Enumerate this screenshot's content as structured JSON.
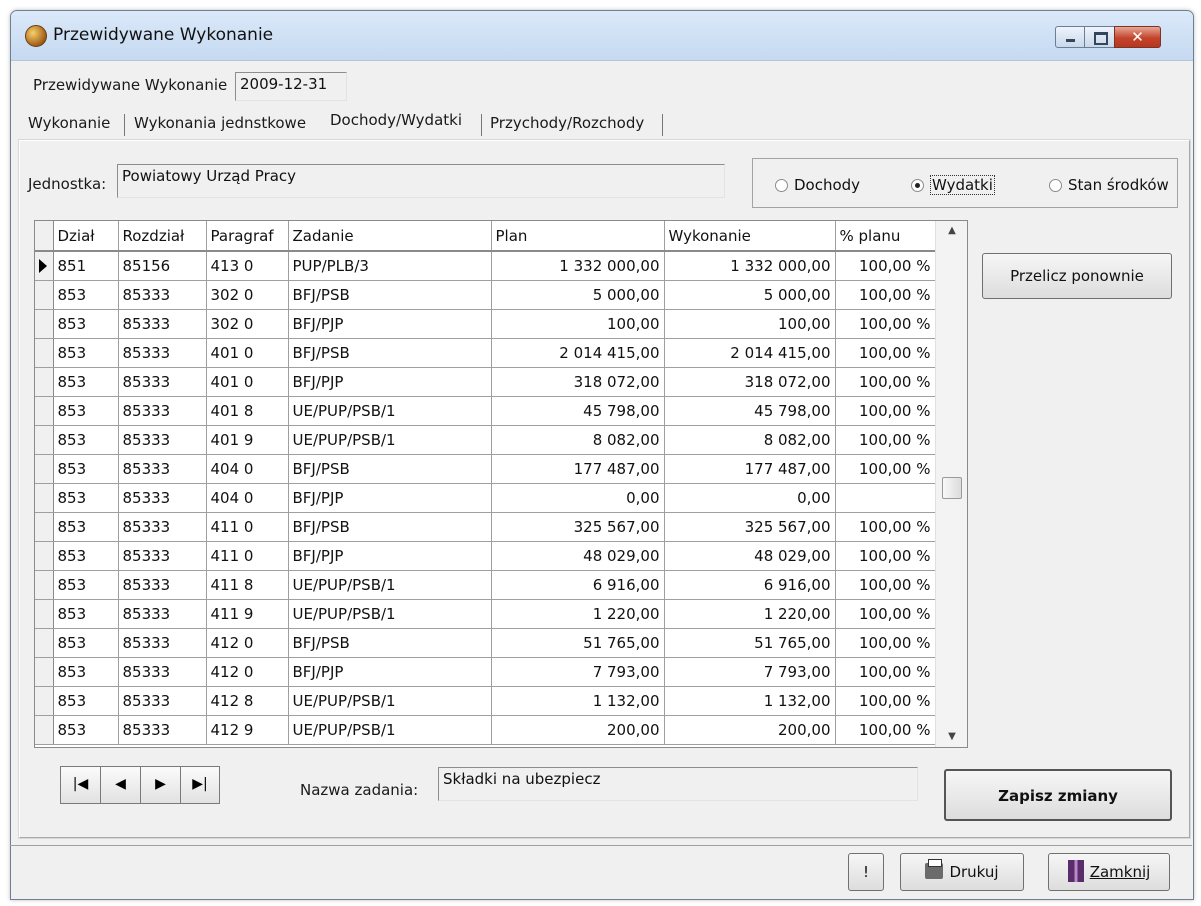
{
  "window": {
    "title": "Przewidywane Wykonanie"
  },
  "header": {
    "date_label": "Przewidywane Wykonanie",
    "date_value": "2009-12-31"
  },
  "tabs": [
    {
      "label": "Wykonanie"
    },
    {
      "label": "Wykonania jednstkowe"
    },
    {
      "label": "Dochody/Wydatki",
      "active": true
    },
    {
      "label": "Przychody/Rozchody"
    }
  ],
  "unit": {
    "label": "Jednostka:",
    "value": "Powiatowy Urząd Pracy"
  },
  "radio": {
    "options": [
      {
        "label": "Dochody",
        "selected": false
      },
      {
        "label": "Wydatki",
        "selected": true
      },
      {
        "label": "Stan środków",
        "selected": false
      }
    ]
  },
  "grid": {
    "columns": [
      "Dział",
      "Rozdział",
      "Paragraf",
      "Zadanie",
      "Plan",
      "Wykonanie",
      "% planu"
    ],
    "rows": [
      [
        "851",
        "85156",
        "413 0",
        "PUP/PLB/3",
        "1 332 000,00",
        "1 332 000,00",
        "100,00 %"
      ],
      [
        "853",
        "85333",
        "302 0",
        "BFJ/PSB",
        "5 000,00",
        "5 000,00",
        "100,00 %"
      ],
      [
        "853",
        "85333",
        "302 0",
        "BFJ/PJP",
        "100,00",
        "100,00",
        "100,00 %"
      ],
      [
        "853",
        "85333",
        "401 0",
        "BFJ/PSB",
        "2 014 415,00",
        "2 014 415,00",
        "100,00 %"
      ],
      [
        "853",
        "85333",
        "401 0",
        "BFJ/PJP",
        "318 072,00",
        "318 072,00",
        "100,00 %"
      ],
      [
        "853",
        "85333",
        "401 8",
        "UE/PUP/PSB/1",
        "45 798,00",
        "45 798,00",
        "100,00 %"
      ],
      [
        "853",
        "85333",
        "401 9",
        "UE/PUP/PSB/1",
        "8 082,00",
        "8 082,00",
        "100,00 %"
      ],
      [
        "853",
        "85333",
        "404 0",
        "BFJ/PSB",
        "177 487,00",
        "177 487,00",
        "100,00 %"
      ],
      [
        "853",
        "85333",
        "404 0",
        "BFJ/PJP",
        "0,00",
        "0,00",
        ""
      ],
      [
        "853",
        "85333",
        "411 0",
        "BFJ/PSB",
        "325 567,00",
        "325 567,00",
        "100,00 %"
      ],
      [
        "853",
        "85333",
        "411 0",
        "BFJ/PJP",
        "48 029,00",
        "48 029,00",
        "100,00 %"
      ],
      [
        "853",
        "85333",
        "411 8",
        "UE/PUP/PSB/1",
        "6 916,00",
        "6 916,00",
        "100,00 %"
      ],
      [
        "853",
        "85333",
        "411 9",
        "UE/PUP/PSB/1",
        "1 220,00",
        "1 220,00",
        "100,00 %"
      ],
      [
        "853",
        "85333",
        "412 0",
        "BFJ/PSB",
        "51 765,00",
        "51 765,00",
        "100,00 %"
      ],
      [
        "853",
        "85333",
        "412 0",
        "BFJ/PJP",
        "7 793,00",
        "7 793,00",
        "100,00 %"
      ],
      [
        "853",
        "85333",
        "412 8",
        "UE/PUP/PSB/1",
        "1 132,00",
        "1 132,00",
        "100,00 %"
      ],
      [
        "853",
        "85333",
        "412 9",
        "UE/PUP/PSB/1",
        "200,00",
        "200,00",
        "100,00 %"
      ]
    ],
    "current_row": 0
  },
  "buttons": {
    "recalc": "Przelicz ponownie",
    "save": "Zapisz zmiany",
    "exclaim": "!",
    "print": "Drukuj",
    "close": "Zamknij"
  },
  "task": {
    "label": "Nazwa zadania:",
    "value": "Składki na ubezpiecz"
  },
  "navigator": [
    {
      "name": "first-record-button",
      "glyph": "|◀"
    },
    {
      "name": "prev-record-button",
      "glyph": "◀"
    },
    {
      "name": "next-record-button",
      "glyph": "▶"
    },
    {
      "name": "last-record-button",
      "glyph": "▶|"
    }
  ],
  "colors": {
    "title_bar": "#c5d9f1",
    "close_button": "#c3452b",
    "window_bg": "#f0f0f0"
  }
}
